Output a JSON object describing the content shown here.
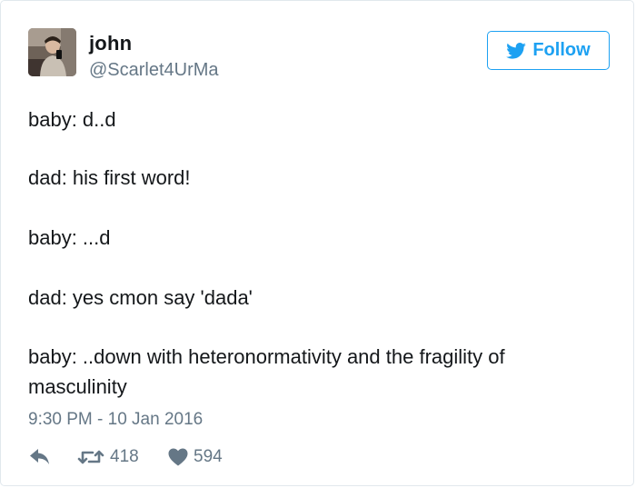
{
  "user": {
    "name": "john",
    "handle": "@Scarlet4UrMa"
  },
  "follow_button": {
    "label": "Follow",
    "icon": "twitter-bird-icon"
  },
  "tweet": {
    "lines": [
      "baby: d..d",
      "dad: his first word!",
      "baby: ...d",
      "dad: yes cmon say 'dada'",
      "baby: ..down with heteronormativity and the fragility of",
      "masculinity"
    ],
    "timestamp": "9:30 PM - 10 Jan 2016"
  },
  "actions": {
    "reply_icon": "reply-icon",
    "retweet_icon": "retweet-icon",
    "retweet_count": "418",
    "like_icon": "heart-icon",
    "like_count": "594"
  },
  "colors": {
    "accent": "#1da1f2",
    "text": "#14171a",
    "secondary": "#657786",
    "border": "#e1e8ed"
  }
}
